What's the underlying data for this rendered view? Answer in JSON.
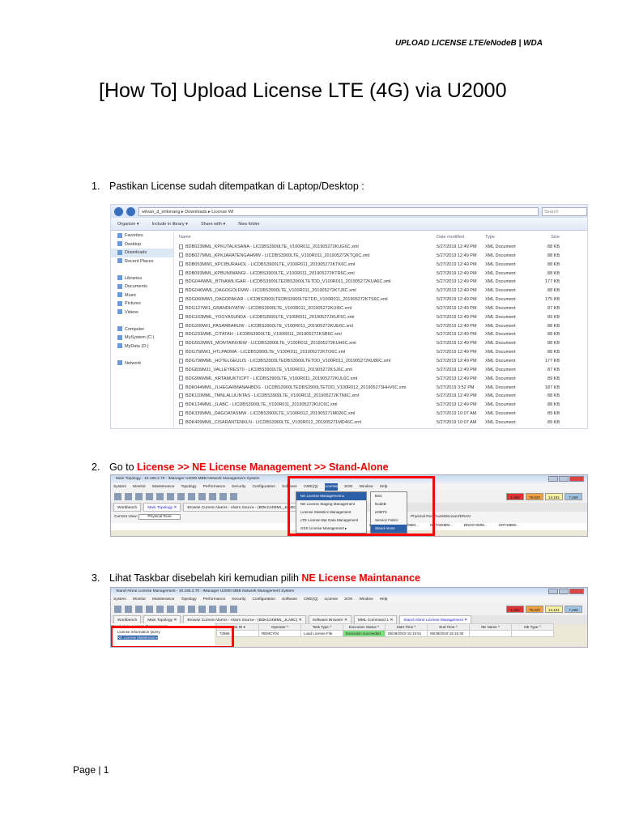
{
  "header": "UPLOAD LICENSE LTE/eNodeB | WDA",
  "title": "[How To] Upload License LTE (4G) via U2000",
  "steps": [
    {
      "num": "1.",
      "text": "Pastikan License sudah ditempatkan di Laptop/Desktop :"
    },
    {
      "num": "2.",
      "text": "Go to ",
      "highlight": "License >> NE License Management >> Stand-Alone"
    },
    {
      "num": "3.",
      "text": "Lihat Taskbar disebelah kiri kemudian pilih ",
      "highlight": "NE License Maintanance"
    }
  ],
  "explorer": {
    "path": "wilvan_d_eritonang  ▸  Downloads  ▸  License WI",
    "search": "Search",
    "toolbar": [
      "Organize ▾",
      "Include in library ▾",
      "Share with ▾",
      "New folder"
    ],
    "sidebar": [
      "Favorites",
      "Desktop",
      "Downloads",
      "Recent Places",
      "",
      "Libraries",
      "Documents",
      "Music",
      "Pictures",
      "Videos",
      "",
      "Computer",
      "MySystem (C:)",
      "MyData (D:)",
      "",
      "Network"
    ],
    "columns": [
      "Name",
      "Date modified",
      "Type",
      "Size"
    ],
    "files": [
      [
        "BDB023MML_KPKUTALKSANA - LICDBS3900LTE_V100R011_201905272KUG6C.xml",
        "5/27/2019 12:49 PM",
        "XML Document",
        "88 KB"
      ],
      [
        "BDB027MML_KPKJARATENGAHMW - LICDBS3900LTE_V100R011_201905272KTQ6C.xml",
        "5/27/2019 12:49 PM",
        "XML Document",
        "88 KB"
      ],
      [
        "BDB053MW1_KPCIBURAHOL - LICDBS3900LTE_V100R011_201905272KTK6C.xml",
        "5/27/2019 12:49 PM",
        "XML Document",
        "88 KB"
      ],
      [
        "BDB093MML_KPBUNIWANGI - LICDBS3900LTE_V100R011_201905272KTR6C.xml",
        "5/27/2019 12:49 PM",
        "XML Document",
        "88 KB"
      ],
      [
        "BDG044WML_BTNAWILIGAR - LICDBS3900LTEDBS3900LTETDD_V100R011_201905272KUA6C.xml",
        "5/27/2019 12:49 PM",
        "XML Document",
        "177 KB"
      ],
      [
        "BDG046WML_DAGOGOLFMW - LICDBS3900LTE_V100R011_201905272KTJ6C.xml",
        "5/27/2019 12:49 PM",
        "XML Document",
        "88 KB"
      ],
      [
        "BDG060MW1_DAGOPAKAR - LICDBS3900LTEDBS3900LTETDD_V100R011_201905272KTS6C.xml",
        "5/27/2019 12:49 PM",
        "XML Document",
        "175 KB"
      ],
      [
        "BDG127WI1_GRANDHYATW - LICDBS3900LTE_V100R011_201905272KUI6C.xml",
        "5/27/2019 12:49 PM",
        "XML Document",
        "87 KB"
      ],
      [
        "BDG163MML_YOGYASUNDA - LICDBS3900LTE_V100R011_201905272KUF6C.xml",
        "5/27/2019 12:49 PM",
        "XML Document",
        "89 KB"
      ],
      [
        "BDG209WI1_PASARBARUW - LICDBS3900LTE_V100R011_201905272KUE6C.xml",
        "5/27/2019 12:49 PM",
        "XML Document",
        "88 KB"
      ],
      [
        "BDG231MML_CITATAH - LICDBS3900LTE_V100R011_201905272KSB6C.xml",
        "5/27/2019 12:49 PM",
        "XML Document",
        "88 KB"
      ],
      [
        "BDG552MW1_MONTAINVIEW - LICDBS3900LTE_V100R011_201905272KUH6C.xml",
        "5/27/2019 12:49 PM",
        "XML Document",
        "88 KB"
      ],
      [
        "BDG758WI1_HTLPADMA - LICDBS3900LTE_V100R011_201905272KTO6C.xml",
        "5/27/2019 12:49 PM",
        "XML Document",
        "88 KB"
      ],
      [
        "BDG798MML_HOTELGEULIS - LICDBS3900LTEDBS3900LTETDD_V100R011_201905272KU86C.xml",
        "5/27/2019 12:49 PM",
        "XML Document",
        "177 KB"
      ],
      [
        "BDG839MJ1_VALLEYREST0 - LICDBS3900LTE_V100R011_201905272KSJ6C.xml",
        "5/27/2019 12:49 PM",
        "XML Document",
        "87 KB"
      ],
      [
        "BDG996MML_KRTAMUKTICPT - LICDBS3900LTE_V100R011_201905272KUL6C.xml",
        "5/27/2019 12:49 PM",
        "XML Document",
        "89 KB"
      ],
      [
        "BDK044MML_JLHEGARMANAHBDG - LICDBS3900LTEDBS3900LTETDD_V100R012_201905273HHV6C.xml",
        "5/27/2019 3:52 PM",
        "XML Document",
        "187 KB"
      ],
      [
        "BDK110MML_TMNLALULINTAS - LICDBS3900LTE_V100R011_201905272KTN6C.xml",
        "5/27/2019 12:49 PM",
        "XML Document",
        "88 KB"
      ],
      [
        "BDK124MML_JLABC - LICDBS3900LTE_V100R011_201905272KUC6C.xml",
        "5/27/2019 12:49 PM",
        "XML Document",
        "88 KB"
      ],
      [
        "BDK339MML_DAGOATASMW - LICDBS3900LTE_V100R012_201905271M026C.xml",
        "5/27/2019 10:07 AM",
        "XML Document",
        "89 KB"
      ],
      [
        "BDK409MML_CISARANTENKLN - LICDBS3900LTE_V100R012_201905271MD46C.xml",
        "5/27/2019 10:07 AM",
        "XML Document",
        "89 KB"
      ]
    ]
  },
  "u2000_a": {
    "title": "Main Topology - 10.165.2.70 - iManager U2000 MBB Network Management System",
    "menu": [
      "System",
      "Monitor",
      "Maintenance",
      "Topology",
      "Performance",
      "Security",
      "Configuration",
      "Software",
      "CME(Q)",
      "License",
      "SON",
      "Window",
      "Help"
    ],
    "alarms": [
      "1,090",
      "79,020",
      "14,181",
      "7,469"
    ],
    "tabs": [
      "Workbench",
      "Main Topology ✕",
      "Browse Current Alarms - Alarm Source - (BDK124MML_JLABC)"
    ],
    "current_view_label": "Current View:",
    "current_view": "Physical Root",
    "license_menu": [
      "NE License Management ▸",
      "NE License Staging Management",
      "License Statistics Management",
      "LTE License Bar Data Management",
      "GSS License Management ▸"
    ],
    "submenu": [
      "BSC",
      "NodeB",
      "eGBTS",
      "Service Fabric",
      "Stand-Alone"
    ],
    "right_text": "Physical Root/AutoDiscover/ERAN",
    "nodes": [
      "CAF...",
      "GRT025MM...",
      "CAPGT...",
      "BDG060MM...",
      "GRT025MM...",
      "BDG074MM...",
      "GRT18BW..."
    ]
  },
  "u2000_b": {
    "title": "Stand-Alone License Management - 10.165.2.70 - iManager U2000 MBB Network Management System",
    "tabs": [
      "Workbench",
      "Main Topology ✕",
      "Browse Current Alarms - Alarm Source - (BDK124MML_JLABC) ✕",
      "Software Browser ✕",
      "MML Command 1 ✕",
      "Stand-Alone License Management ✕"
    ],
    "tree": [
      "Stand-Alone License Management",
      "License Information Query",
      "NE License Maintenance"
    ],
    "columns": [
      "Task ID ▾",
      "Operator ^",
      "Task Type ^",
      "Execution Status ^",
      "Start Time ^",
      "End Time ^",
      "NE Name ^",
      "NE Type ^"
    ],
    "row": [
      "72666",
      "REMCY04",
      "Load License File",
      "Execution succeeded",
      "05/28/2019 15:15:51",
      "05/28/2019 15:16:30",
      "",
      ""
    ]
  },
  "footer": "Page | 1",
  "colors": {
    "highlight": "#ee0000",
    "box": "#ff0000"
  }
}
